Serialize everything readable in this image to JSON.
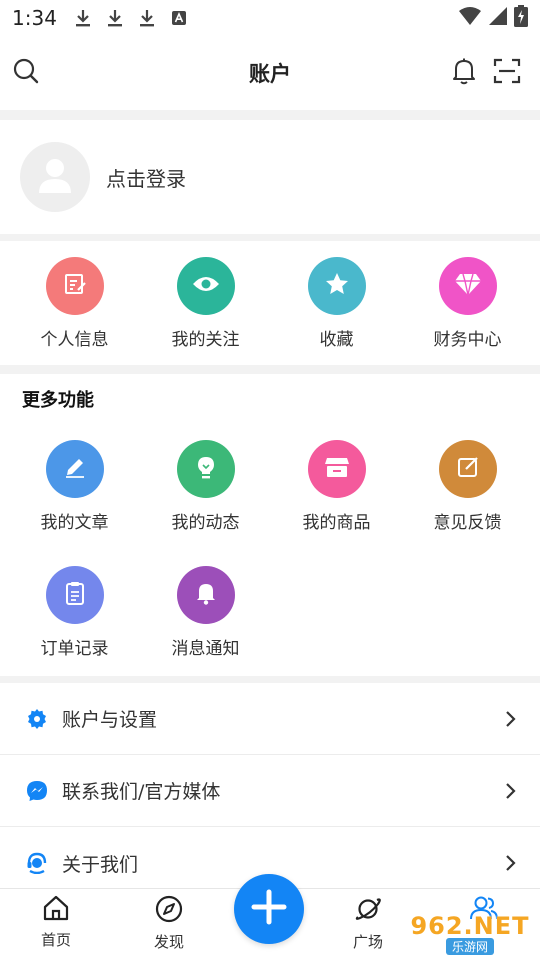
{
  "status": {
    "time": "1:34"
  },
  "header": {
    "title": "账户"
  },
  "login": {
    "text": "点击登录"
  },
  "quick": [
    {
      "label": "个人信息",
      "color": "#f47a7a",
      "icon": "profile-edit-icon"
    },
    {
      "label": "我的关注",
      "color": "#2bb59a",
      "icon": "eye-icon"
    },
    {
      "label": "收藏",
      "color": "#4ab8cc",
      "icon": "star-icon"
    },
    {
      "label": "财务中心",
      "color": "#f054c7",
      "icon": "diamond-icon"
    }
  ],
  "more": {
    "title": "更多功能",
    "items": [
      {
        "label": "我的文章",
        "color": "#4c97e8",
        "icon": "pencil-icon"
      },
      {
        "label": "我的动态",
        "color": "#3cb878",
        "icon": "lightbulb-icon"
      },
      {
        "label": "我的商品",
        "color": "#f45a9c",
        "icon": "shop-icon"
      },
      {
        "label": "意见反馈",
        "color": "#d08a3a",
        "icon": "feedback-edit-icon"
      },
      {
        "label": "订单记录",
        "color": "#7487ec",
        "icon": "clipboard-icon"
      },
      {
        "label": "消息通知",
        "color": "#9c4fb9",
        "icon": "bell-icon"
      }
    ]
  },
  "list": [
    {
      "label": "账户与设置",
      "icon": "gear-icon"
    },
    {
      "label": "联系我们/官方媒体",
      "icon": "messenger-icon"
    },
    {
      "label": "关于我们",
      "icon": "support-agent-icon"
    }
  ],
  "tabs": [
    {
      "label": "首页",
      "icon": "home-icon"
    },
    {
      "label": "发现",
      "icon": "compass-icon"
    },
    {
      "label": "广场",
      "icon": "planet-icon"
    }
  ],
  "accent": "#1385f5",
  "watermark": {
    "main": "962.NET",
    "sub": "乐游网"
  }
}
